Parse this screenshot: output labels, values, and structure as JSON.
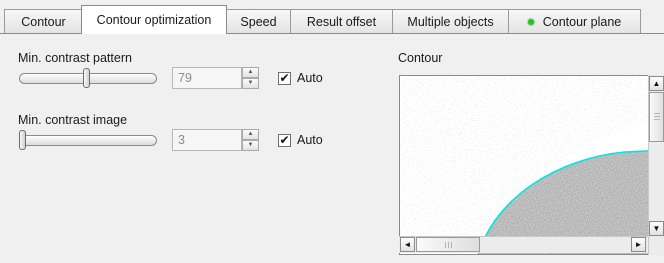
{
  "tabs": [
    {
      "label": "Contour",
      "active": false
    },
    {
      "label": "Contour optimization",
      "active": true
    },
    {
      "label": "Speed",
      "active": false
    },
    {
      "label": "Result offset",
      "active": false
    },
    {
      "label": "Multiple objects",
      "active": false
    },
    {
      "label": "Contour plane",
      "active": false,
      "status_icon": "green-dot-icon",
      "status_color": "#22c422"
    }
  ],
  "pattern": {
    "label": "Min. contrast pattern",
    "slider_fraction": 0.49,
    "value": "79",
    "auto_label": "Auto",
    "auto_checked": true
  },
  "image": {
    "label": "Min. contrast image",
    "slider_fraction": 0.0,
    "value": "3",
    "auto_label": "Auto",
    "auto_checked": true
  },
  "contour": {
    "label": "Contour",
    "contour_color": "#00e5e5"
  },
  "icons": {
    "check": "✔",
    "spin_up": "▲",
    "spin_down": "▼",
    "scroll_up": "▲",
    "scroll_down": "▼",
    "scroll_left": "◄",
    "scroll_right": "►"
  }
}
